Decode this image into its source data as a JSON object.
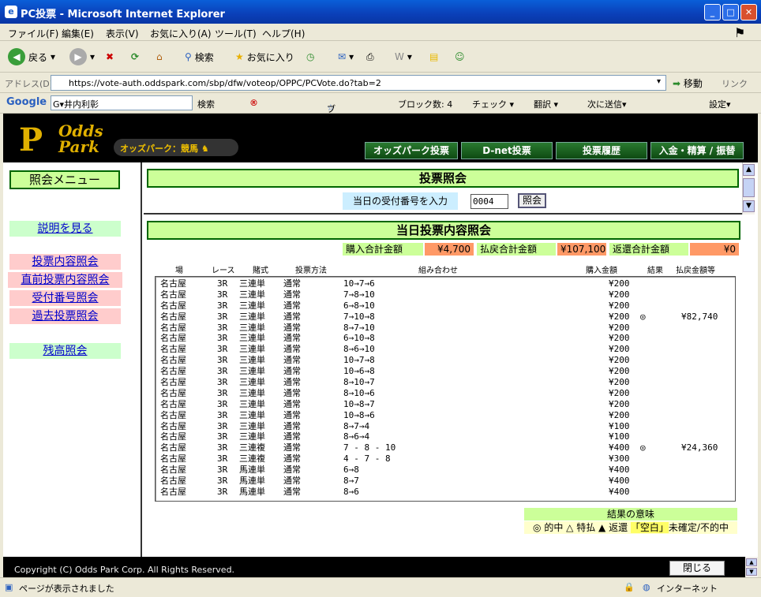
{
  "window": {
    "title": "PC投票 - Microsoft Internet Explorer"
  },
  "menu": [
    "ファイル(F)",
    "編集(E)",
    "表示(V)",
    "お気に入り(A)",
    "ツール(T)",
    "ヘルプ(H)"
  ],
  "toolbar": {
    "back": "戻る",
    "search": "検索",
    "favorites": "お気に入り"
  },
  "address": {
    "label": "アドレス(D)",
    "url": "https://vote-auth.oddspark.com/sbp/dfw/voteop/OPPC/PCVote.do?tab=2",
    "go": "移動",
    "links": "リンク"
  },
  "google": {
    "search_text": "G▾井内利彰",
    "search": "検索",
    "bookmarks": "ブックマーク▾",
    "blocked": "ブロック数: 4",
    "check": "チェック ▾",
    "translate": "翻訳 ▾",
    "send": "次に送信▾",
    "settings": "設定▾"
  },
  "header": {
    "logo_line1": "Odds",
    "logo_line2": "Park",
    "subbrand": "オッズパーク：競馬",
    "nav": [
      "オッズパーク投票",
      "D-net投票",
      "投票履歴",
      "入金・精算 / 振替"
    ]
  },
  "sidebar": {
    "title": "照会メニュー",
    "help": "説明を見る",
    "items": [
      "投票内容照会",
      "直前投票内容照会",
      "受付番号照会",
      "過去投票照会"
    ],
    "balance": "残高照会"
  },
  "inquiry": {
    "title": "投票照会",
    "entry_label": "当日の受付番号を入力",
    "entry_value": "0004",
    "entry_button": "照会"
  },
  "summary": {
    "title": "当日投票内容照会",
    "purchase_label": "購入合計金額",
    "purchase_value": "¥4,700",
    "payout_label": "払戻合計金額",
    "payout_value": "¥107,100",
    "refund_label": "返還合計金額",
    "refund_value": "¥0"
  },
  "table": {
    "headers": [
      "場",
      "レース",
      "賭式",
      "投票方法",
      "組み合わせ",
      "購入金額",
      "結果",
      "払戻金額等"
    ],
    "rows": [
      [
        "名古屋",
        "3R",
        "三連単",
        "通常",
        "10→7→6",
        "¥200",
        "",
        ""
      ],
      [
        "名古屋",
        "3R",
        "三連単",
        "通常",
        "7→8→10",
        "¥200",
        "",
        ""
      ],
      [
        "名古屋",
        "3R",
        "三連単",
        "通常",
        "6→8→10",
        "¥200",
        "",
        ""
      ],
      [
        "名古屋",
        "3R",
        "三連単",
        "通常",
        "7→10→8",
        "¥200",
        "◎",
        "¥82,740"
      ],
      [
        "名古屋",
        "3R",
        "三連単",
        "通常",
        "8→7→10",
        "¥200",
        "",
        ""
      ],
      [
        "名古屋",
        "3R",
        "三連単",
        "通常",
        "6→10→8",
        "¥200",
        "",
        ""
      ],
      [
        "名古屋",
        "3R",
        "三連単",
        "通常",
        "8→6→10",
        "¥200",
        "",
        ""
      ],
      [
        "名古屋",
        "3R",
        "三連単",
        "通常",
        "10→7→8",
        "¥200",
        "",
        ""
      ],
      [
        "名古屋",
        "3R",
        "三連単",
        "通常",
        "10→6→8",
        "¥200",
        "",
        ""
      ],
      [
        "名古屋",
        "3R",
        "三連単",
        "通常",
        "8→10→7",
        "¥200",
        "",
        ""
      ],
      [
        "名古屋",
        "3R",
        "三連単",
        "通常",
        "8→10→6",
        "¥200",
        "",
        ""
      ],
      [
        "名古屋",
        "3R",
        "三連単",
        "通常",
        "10→8→7",
        "¥200",
        "",
        ""
      ],
      [
        "名古屋",
        "3R",
        "三連単",
        "通常",
        "10→8→6",
        "¥200",
        "",
        ""
      ],
      [
        "名古屋",
        "3R",
        "三連単",
        "通常",
        "8→7→4",
        "¥100",
        "",
        ""
      ],
      [
        "名古屋",
        "3R",
        "三連単",
        "通常",
        "8→6→4",
        "¥100",
        "",
        ""
      ],
      [
        "名古屋",
        "3R",
        "三連複",
        "通常",
        "7 - 8 - 10",
        "¥400",
        "◎",
        "¥24,360"
      ],
      [
        "名古屋",
        "3R",
        "三連複",
        "通常",
        "4 - 7 - 8",
        "¥300",
        "",
        ""
      ],
      [
        "名古屋",
        "3R",
        "馬連単",
        "通常",
        "6→8",
        "¥400",
        "",
        ""
      ],
      [
        "名古屋",
        "3R",
        "馬連単",
        "通常",
        "8→7",
        "¥400",
        "",
        ""
      ],
      [
        "名古屋",
        "3R",
        "馬連単",
        "通常",
        "8→6",
        "¥400",
        "",
        ""
      ]
    ]
  },
  "legend": {
    "title": "結果の意味",
    "hit": "◎ 的中",
    "special": "△ 特払",
    "refund": "▲ 返還",
    "blank": "「空白」",
    "unsettled": "未確定/不的中"
  },
  "footer": {
    "copyright": "Copyright (C) Odds Park Corp. All Rights Reserved.",
    "close": "閉じる"
  },
  "status": {
    "text": "ページが表示されました",
    "zone": "インターネット"
  }
}
